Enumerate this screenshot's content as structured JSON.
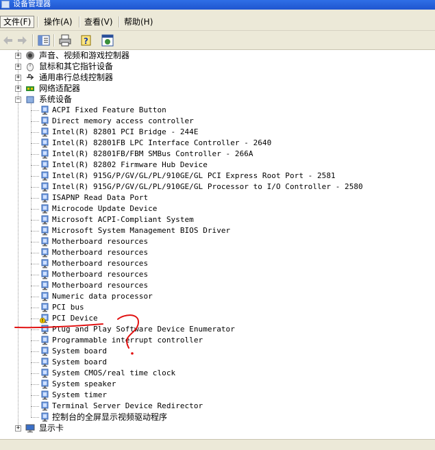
{
  "window": {
    "title": "设备管理器"
  },
  "menu": [
    {
      "label": "文件(F)",
      "active": true
    },
    {
      "label": "操作(A)",
      "active": false
    },
    {
      "label": "查看(V)",
      "active": false
    },
    {
      "label": "帮助(H)",
      "active": false
    }
  ],
  "toolbar": {
    "buttons": [
      {
        "name": "back-icon",
        "enabled": false
      },
      {
        "name": "forward-icon",
        "enabled": false
      },
      {
        "name": "properties-pane-icon",
        "enabled": true
      },
      {
        "name": "print-icon",
        "enabled": true
      },
      {
        "name": "help-icon",
        "enabled": true
      },
      {
        "name": "console-tree-icon",
        "enabled": true
      }
    ]
  },
  "tree": {
    "categories_before": [
      {
        "label": "声音、视频和游戏控制器",
        "icon": "speaker-icon"
      },
      {
        "label": "鼠标和其它指针设备",
        "icon": "mouse-icon"
      },
      {
        "label": "通用串行总线控制器",
        "icon": "usb-icon"
      },
      {
        "label": "网络适配器",
        "icon": "network-card-icon"
      }
    ],
    "system_devices": {
      "label": "系统设备",
      "expanded": true,
      "items": [
        {
          "label": "ACPI Fixed Feature Button",
          "warning": false
        },
        {
          "label": "Direct memory access controller",
          "warning": false
        },
        {
          "label": "Intel(R) 82801 PCI Bridge - 244E",
          "warning": false
        },
        {
          "label": "Intel(R) 82801FB LPC Interface Controller - 2640",
          "warning": false
        },
        {
          "label": "Intel(R) 82801FB/FBM SMBus Controller - 266A",
          "warning": false
        },
        {
          "label": "Intel(R) 82802 Firmware Hub Device",
          "warning": false
        },
        {
          "label": "Intel(R) 915G/P/GV/GL/PL/910GE/GL PCI Express Root Port - 2581",
          "warning": false
        },
        {
          "label": "Intel(R) 915G/P/GV/GL/PL/910GE/GL Processor to I/O Controller - 2580",
          "warning": false
        },
        {
          "label": "ISAPNP Read Data Port",
          "warning": false
        },
        {
          "label": "Microcode Update Device",
          "warning": false
        },
        {
          "label": "Microsoft ACPI-Compliant System",
          "warning": false
        },
        {
          "label": "Microsoft System Management BIOS Driver",
          "warning": false
        },
        {
          "label": "Motherboard resources",
          "warning": false
        },
        {
          "label": "Motherboard resources",
          "warning": false
        },
        {
          "label": "Motherboard resources",
          "warning": false
        },
        {
          "label": "Motherboard resources",
          "warning": false
        },
        {
          "label": "Motherboard resources",
          "warning": false
        },
        {
          "label": "Numeric data processor",
          "warning": false
        },
        {
          "label": "PCI bus",
          "warning": false
        },
        {
          "label": "PCI Device",
          "warning": true
        },
        {
          "label": "Plug and Play Software Device Enumerator",
          "warning": false
        },
        {
          "label": "Programmable interrupt controller",
          "warning": false
        },
        {
          "label": "System board",
          "warning": false
        },
        {
          "label": "System board",
          "warning": false
        },
        {
          "label": "System CMOS/real time clock",
          "warning": false
        },
        {
          "label": "System speaker",
          "warning": false
        },
        {
          "label": "System timer",
          "warning": false
        },
        {
          "label": "Terminal Server Device Redirector",
          "warning": false
        },
        {
          "label": "控制台的全屏显示视频驱动程序",
          "warning": false
        }
      ]
    },
    "categories_after": [
      {
        "label": "显示卡",
        "icon": "monitor-icon"
      }
    ]
  },
  "colors": {
    "titlebar": "#2f6fe6",
    "chrome": "#ece9d8",
    "annotation": "#e11010",
    "warning": "#f0c800"
  }
}
